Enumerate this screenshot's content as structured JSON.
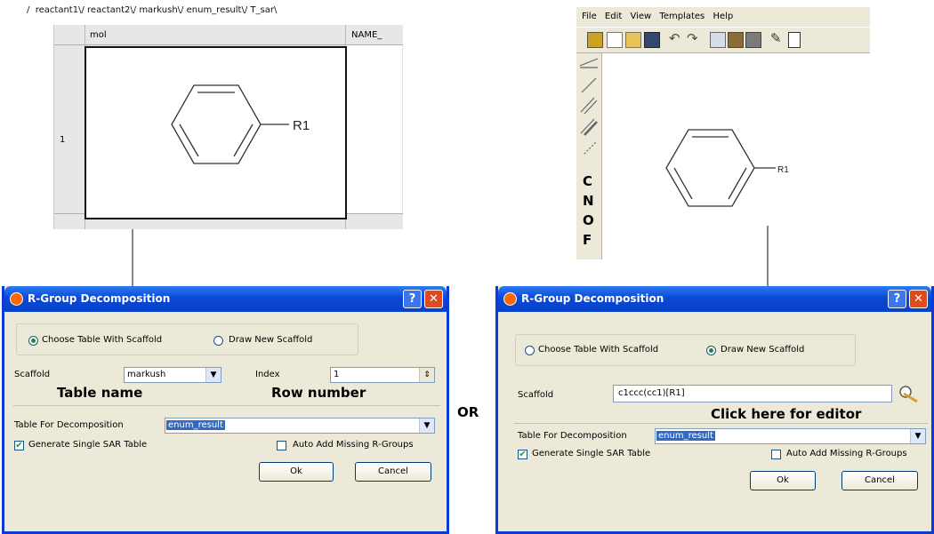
{
  "sheet": {
    "tabs": [
      "reactant1",
      "reactant2",
      "markush",
      "enum_result",
      "T_sar"
    ],
    "col_mol": "mol",
    "col_name": "NAME_",
    "row_number": "1",
    "r_label": "R1"
  },
  "editor": {
    "menu": [
      "File",
      "Edit",
      "View",
      "Templates",
      "Help"
    ],
    "atoms": [
      "C",
      "N",
      "O",
      "F"
    ],
    "r_label": "R1"
  },
  "dialog_left": {
    "title": "R-Group Decomposition",
    "help_btn": "?",
    "close_btn": "✕",
    "radio_table": "Choose Table With Scaffold",
    "radio_draw": "Draw New Scaffold",
    "scaffold_label": "Scaffold",
    "scaffold_value": "markush",
    "index_label": "Index",
    "index_value": "1",
    "note_table": "Table name",
    "note_row": "Row number",
    "decomp_label": "Table For Decomposition",
    "decomp_value": "enum_result",
    "gen_sar": "Generate Single SAR Table",
    "auto_add": "Auto Add Missing R-Groups",
    "ok": "Ok",
    "cancel": "Cancel"
  },
  "or_text": "OR",
  "dialog_right": {
    "title": "R-Group Decomposition",
    "help_btn": "?",
    "close_btn": "✕",
    "radio_table": "Choose Table With Scaffold",
    "radio_draw": "Draw New Scaffold",
    "scaffold_label": "Scaffold",
    "scaffold_value": "c1ccc(cc1)[R1]",
    "note_editor": "Click here for editor",
    "decomp_label": "Table For Decomposition",
    "decomp_value": "enum_result",
    "gen_sar": "Generate Single SAR Table",
    "auto_add": "Auto Add Missing R-Groups",
    "ok": "Ok",
    "cancel": "Cancel"
  }
}
